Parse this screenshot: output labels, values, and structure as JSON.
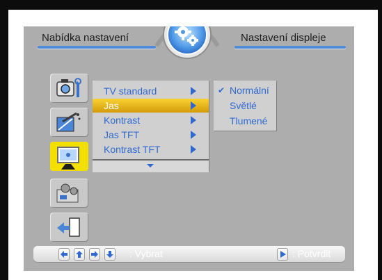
{
  "header": {
    "left_title": "Nabídka nastavení",
    "right_title": "Nastavení displeje",
    "badge_icon": "gears-icon"
  },
  "sidebar": {
    "items": [
      {
        "name": "camera-settings",
        "icon": "camera-wrench-icon",
        "active": false
      },
      {
        "name": "tv-antenna",
        "icon": "antenna-tv-icon",
        "active": false
      },
      {
        "name": "display",
        "icon": "monitor-icon",
        "active": true
      },
      {
        "name": "settings-folder",
        "icon": "gears-folder-icon",
        "active": false
      },
      {
        "name": "exit",
        "icon": "exit-door-icon",
        "active": false
      }
    ]
  },
  "menu": {
    "items": [
      {
        "label": "TV standard",
        "selected": false
      },
      {
        "label": "Jas",
        "selected": true
      },
      {
        "label": "Kontrast",
        "selected": false
      },
      {
        "label": "Jas TFT",
        "selected": false
      },
      {
        "label": "Kontrast TFT",
        "selected": false
      }
    ],
    "more_indicator": "down-arrow-icon"
  },
  "submenu": {
    "items": [
      {
        "label": "Normální",
        "checked": true
      },
      {
        "label": "Světlé",
        "checked": false
      },
      {
        "label": "Tlumené",
        "checked": false
      }
    ],
    "check_glyph": "✔"
  },
  "footer": {
    "select_label": ": Vybrat",
    "confirm_label": ": Potvrdit",
    "nav_icons": [
      "arrow-left-icon",
      "arrow-up-icon",
      "arrow-right-icon",
      "arrow-down-icon"
    ],
    "confirm_icon": "play-icon"
  },
  "colors": {
    "screen_bg": "#adadad",
    "accent_blue": "#2f69d0",
    "highlight_yellow": "#f4e000",
    "selection_gold": "#e0b020"
  }
}
